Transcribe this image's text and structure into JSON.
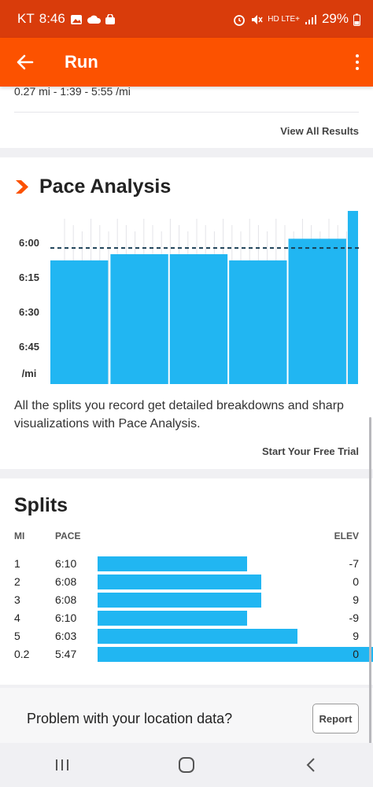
{
  "status_bar": {
    "carrier": "KT",
    "time": "8:46",
    "network": "HD LTE+",
    "battery": "29%"
  },
  "header": {
    "title": "Run"
  },
  "results": {
    "prev_row": "0.27 mi - 1:39 - 5:55 /mi",
    "view_all": "View All Results"
  },
  "pace_analysis": {
    "title": "Pace Analysis",
    "y_ticks": [
      "6:00",
      "6:15",
      "6:30",
      "6:45",
      "/mi"
    ],
    "description": "All the splits you record get detailed breakdowns and sharp visualizations with Pace Analysis.",
    "cta": "Start Your Free Trial",
    "accent": "#fc5200",
    "bar_color": "#21b6f2"
  },
  "chart_data": {
    "type": "bar",
    "ylabel": "/mi",
    "y_ticks": [
      "6:00",
      "6:15",
      "6:30",
      "6:45"
    ],
    "ylim_seconds": [
      354,
      410
    ],
    "average_line_seconds": 366,
    "splits": [
      {
        "mi": "1",
        "pace": "6:10",
        "seconds": 370,
        "distance": 1
      },
      {
        "mi": "2",
        "pace": "6:08",
        "seconds": 368,
        "distance": 1
      },
      {
        "mi": "3",
        "pace": "6:08",
        "seconds": 368,
        "distance": 1
      },
      {
        "mi": "4",
        "pace": "6:10",
        "seconds": 370,
        "distance": 1
      },
      {
        "mi": "5",
        "pace": "6:03",
        "seconds": 363,
        "distance": 1
      },
      {
        "mi": "0.2",
        "pace": "5:47",
        "seconds": 347,
        "distance": 0.2
      }
    ]
  },
  "splits": {
    "title": "Splits",
    "headers": {
      "mi": "MI",
      "pace": "PACE",
      "elev": "ELEV"
    },
    "rows": [
      {
        "mi": "1",
        "pace": "6:10",
        "elev": "-7",
        "seconds": 370
      },
      {
        "mi": "2",
        "pace": "6:08",
        "elev": "0",
        "seconds": 368
      },
      {
        "mi": "3",
        "pace": "6:08",
        "elev": "9",
        "seconds": 368
      },
      {
        "mi": "4",
        "pace": "6:10",
        "elev": "-9",
        "seconds": 370
      },
      {
        "mi": "5",
        "pace": "6:03",
        "elev": "9",
        "seconds": 363
      },
      {
        "mi": "0.2",
        "pace": "5:47",
        "elev": "0",
        "seconds": 347
      }
    ]
  },
  "location": {
    "text": "Problem with your location data?",
    "report": "Report"
  },
  "icons": {
    "back": "arrow-left-icon",
    "more": "more-vertical-icon",
    "pace": "chevron-right-icon"
  }
}
